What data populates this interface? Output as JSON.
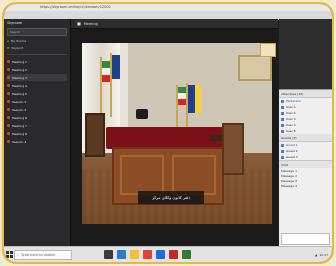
{
  "window": {
    "title": "https://skyroom.online/ch/kanoon/12002"
  },
  "sidebar": {
    "header": "Skyroom",
    "search_placeholder": "Search",
    "links": [
      "My Rooms",
      "Support"
    ],
    "rooms": [
      "Meeting 1",
      "Meeting 2",
      "Meeting 3",
      "Meeting 4",
      "Meeting 5",
      "Session 1",
      "Session 2",
      "Meeting 6",
      "Meeting 7",
      "Meeting 8",
      "Session 3"
    ]
  },
  "center": {
    "stream_name": "Meeting"
  },
  "video": {
    "caption": "دفتر کانون وکلای مرکز"
  },
  "right_panel": {
    "attendees_header": "Attendees (10)",
    "attendees": [
      "Moderator",
      "User 1",
      "User 2",
      "User 3",
      "User 4",
      "User 5"
    ],
    "guests_header": "Guests (3)",
    "guests": [
      "Guest 1",
      "Guest 2",
      "Guest 3"
    ],
    "chat_header": "Chat",
    "chat_lines": [
      "Message 1",
      "Message 2",
      "Message 3",
      "Message 4"
    ]
  },
  "taskbar": {
    "search_text": "Type here to search",
    "time": "10:27"
  },
  "colors": {
    "frame_border": "#e8b93a",
    "desk_cloth": "#7f0f17"
  }
}
